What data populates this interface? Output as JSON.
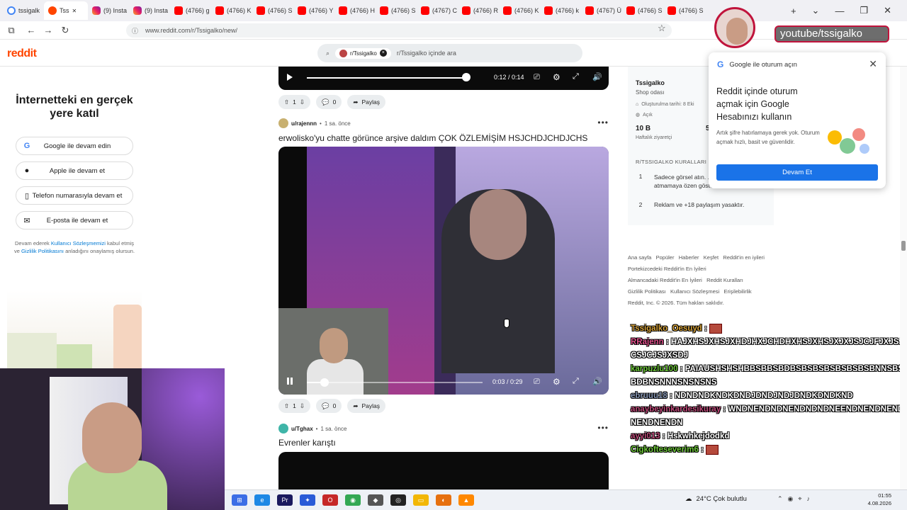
{
  "browser": {
    "tabs": [
      {
        "label": "tssigalk",
        "icon": "google-icon"
      },
      {
        "label": "Tss",
        "icon": "reddit-icon",
        "active": true
      },
      {
        "label": "(9) Insta",
        "icon": "instagram-icon"
      },
      {
        "label": "(9) Insta",
        "icon": "instagram-icon"
      },
      {
        "label": "(4766) g",
        "icon": "youtube-icon"
      },
      {
        "label": "(4766) K",
        "icon": "youtube-icon"
      },
      {
        "label": "(4766) S",
        "icon": "youtube-icon"
      },
      {
        "label": "(4766) Y",
        "icon": "youtube-icon"
      },
      {
        "label": "(4766) H",
        "icon": "youtube-icon"
      },
      {
        "label": "(4766) S",
        "icon": "youtube-icon"
      },
      {
        "label": "(4767) C",
        "icon": "youtube-icon"
      },
      {
        "label": "(4766) R",
        "icon": "youtube-icon"
      },
      {
        "label": "(4766) K",
        "icon": "youtube-icon"
      },
      {
        "label": "(4766) k",
        "icon": "youtube-icon"
      },
      {
        "label": "(4767) Ü",
        "icon": "youtube-icon"
      },
      {
        "label": "(4766) S",
        "icon": "youtube-icon"
      },
      {
        "label": "(4766) S",
        "icon": "youtube-icon"
      }
    ],
    "url": "www.reddit.com/r/Tssigalko/new/"
  },
  "reddit": {
    "logo": "reddit",
    "search_chip": "r/Tssigalko",
    "search_placeholder": "r/Tssigalko içinde ara"
  },
  "signup": {
    "title": "İnternetteki en gerçek yere katıl",
    "buttons": [
      "Google ile devam edin",
      "Apple ile devam et",
      "Telefon numarasıyla devam et",
      "E-posta ile devam et"
    ],
    "legal_pre": "Devam ederek ",
    "legal_link1": "Kullanıcı Sözleşmemizi",
    "legal_mid": " kabul etmiş ve ",
    "legal_link2": "Gizlilik Politikasını",
    "legal_post": " anladığını onaylamış olursun."
  },
  "posts": {
    "p1": {
      "time": "0:12 / 0:14",
      "progress": 0.98,
      "votes": "1",
      "comments": "0",
      "share": "Paylaş"
    },
    "p2": {
      "user": "u/rajennn",
      "age": "1 sa. önce",
      "title": "erwolisko'yu chatte görünce arşive daldım ÇOK ÖZLEMİŞİM HSJCHDJCHDJCHS",
      "time": "0:03 / 0:29",
      "progress": 0.1,
      "votes": "1",
      "comments": "0",
      "share": "Paylaş"
    },
    "p3": {
      "user": "u/Tghax",
      "age": "1 sa. önce",
      "title": "Evrenler karıştı"
    }
  },
  "sidebar": {
    "name": "Tssigalko",
    "type": "Shop odası",
    "created": "Oluşturulma tarihi: 8 Eki",
    "status": "Açık",
    "stat1": "10 B",
    "stat1_label": "Haftalık ziyaretçi",
    "stat2": "5",
    "rules_header": "R/TSSIGALKO KURALLARI",
    "rules": [
      {
        "n": "1",
        "text": "Sadece görsel atın. ... atmamaya özen gösterin."
      },
      {
        "n": "2",
        "text": "Reklam ve +18 paylaşım yasaktır."
      }
    ]
  },
  "footer": {
    "links": [
      "Ana sayfa",
      "Popüler",
      "Haberler",
      "Keşfet",
      "Reddit'in en iyileri",
      "Portekizcedeki Reddit'in En İyileri",
      "Almancadaki Reddit'in En İyileri",
      "Reddit Kuralları",
      "Gizlilik Politikası",
      "Kullanıcı Sözleşmesi",
      "Erişilebilirlik"
    ],
    "copyright": "Reddit, Inc. © 2026. Tüm hakları saklıdır."
  },
  "google_popup": {
    "header": "Google ile oturum açın",
    "title": "Reddit içinde oturum açmak için Google Hesabınızı kullanın",
    "desc": "Artık şifre hatırlamaya gerek yok. Oturum açmak hızlı, basit ve güvenlidir.",
    "button": "Devam Et"
  },
  "stream_overlay": {
    "handle": "youtube/tssigalko"
  },
  "chat": [
    {
      "user": "Tssigalko_Oesuyd",
      "color": "#d9a43a",
      "msg": ""
    },
    {
      "user": "RRajenn",
      "color": "#e0508c",
      "msg": "HAJXHSJXHSJXHDJHXJCHDHXHSJXHSJXJXJSJCJFJXJSJCSJCJSJXSDJ"
    },
    {
      "user": "karpuzlu100",
      "color": "#6ec93a",
      "msg": "PAIAUSHSHSHBBSBBSBDBSBSBSBSBSBSBSBNNSBSBDBNSNNNSNSNSNS"
    },
    {
      "user": "ebruuu18",
      "color": "#8a9ab8",
      "msg": "NDNDNDKNDKDNDJDNDJNDJDNDKDNDKND"
    },
    {
      "user": "anaybeyinkardesikuray",
      "color": "#c04a7a",
      "msg": "WNDNENDNDNENDNDNDNEENDNENDNENDNENDNENDN"
    },
    {
      "user": "ayyi013",
      "color": "#c04a7a",
      "msg": "Hskwhkejdodkd"
    },
    {
      "user": "Cigkofteseverim6",
      "color": "#6ec93a",
      "msg": ""
    }
  ],
  "taskbar": {
    "weather": "24°C  Çok bulutlu",
    "time": "01:55",
    "date": "4.08.2026"
  }
}
